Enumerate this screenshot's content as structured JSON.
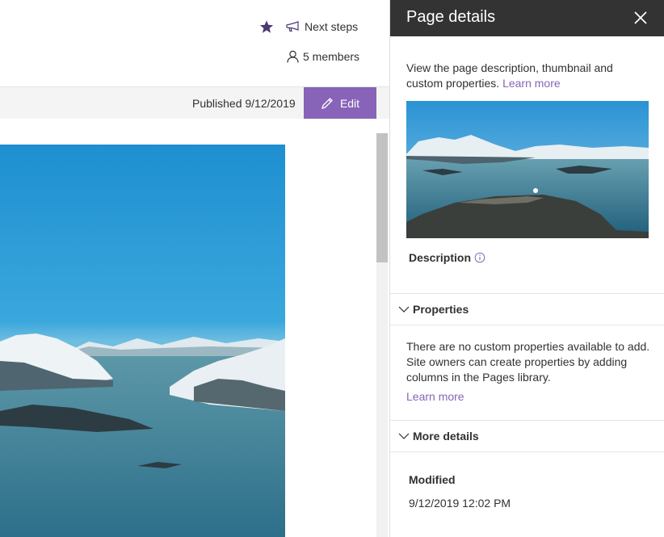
{
  "header": {
    "follow_icon": "star-icon",
    "next_steps_label": "Next steps",
    "next_steps_icon": "megaphone-icon",
    "members_label": "5 members",
    "members_icon": "person-icon"
  },
  "commandbar": {
    "published_text": "Published 9/12/2019",
    "edit_label": "Edit",
    "edit_icon": "pencil-icon"
  },
  "panel": {
    "title": "Page details",
    "close_icon": "close-icon",
    "intro_text": "View the page description, thumbnail and custom properties.",
    "intro_link": "Learn more",
    "description_label": "Description",
    "description_icon": "info-icon",
    "properties": {
      "label": "Properties",
      "chevron_icon": "chevron-down-icon",
      "text": "There are no custom properties available to add. Site owners can create properties by adding columns in the Pages library.",
      "link": "Learn more"
    },
    "more_details": {
      "label": "More details",
      "chevron_icon": "chevron-down-icon",
      "modified_label": "Modified",
      "modified_value": "9/12/2019 12:02 PM"
    }
  },
  "colors": {
    "accent": "#8764b8",
    "panel_header": "#333333",
    "commandbar_bg": "#f4f4f4",
    "text": "#323130"
  }
}
